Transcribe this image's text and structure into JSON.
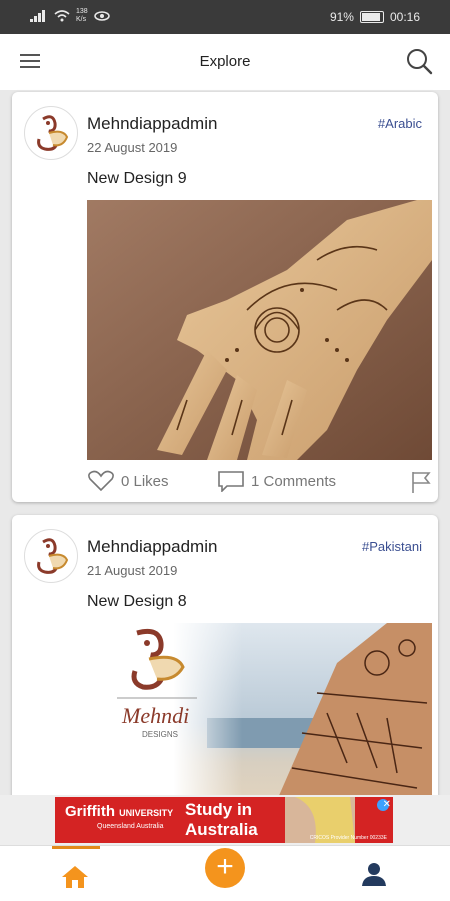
{
  "status_bar": {
    "network_speed_value": "138",
    "network_speed_unit": "K/s",
    "battery": "91%",
    "time": "00:16"
  },
  "appbar": {
    "title": "Explore",
    "menu_icon": "hamburger-menu-icon",
    "search_icon": "search-icon"
  },
  "posts": [
    {
      "username": "Mehndiappadmin",
      "date": "22 August 2019",
      "tag": "#Arabic",
      "title": "New Design 9",
      "likes": "0 Likes",
      "comments": "1 Comments"
    },
    {
      "username": "Mehndiappadmin",
      "date": "21 August 2019",
      "tag": "#Pakistani",
      "title": "New Design 8",
      "logo_text": "Mehndi",
      "logo_subtext": "DESIGNS"
    }
  ],
  "ad": {
    "brand": "Griffith",
    "brand_line2": "UNIVERSITY",
    "brand_sub": "Queensland Australia",
    "headline_1": "Study in",
    "headline_2": "Australia",
    "fine_print": "CRICOS Provider Number 00233E"
  },
  "bottom_nav": {
    "home_icon": "home-icon",
    "add_icon": "plus-icon",
    "add_label": "+",
    "profile_icon": "user-icon"
  },
  "colors": {
    "accent": "#f4941d",
    "tag": "#3b4f91",
    "ad_red": "#d42323"
  }
}
